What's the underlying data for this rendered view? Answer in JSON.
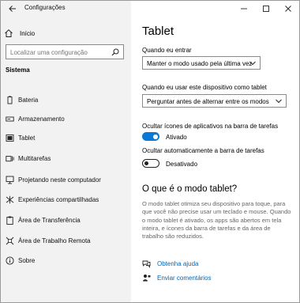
{
  "app": {
    "title": "Configurações"
  },
  "sidebar": {
    "home_label": "Início",
    "search_placeholder": "Localizar uma configuração",
    "section_title": "Sistema",
    "items": [
      {
        "label": "Bateria",
        "icon": "battery-icon"
      },
      {
        "label": "Armazenamento",
        "icon": "storage-icon"
      },
      {
        "label": "Tablet",
        "icon": "tablet-icon"
      },
      {
        "label": "Multitarefas",
        "icon": "multitasking-icon"
      },
      {
        "label": "Projetando neste computador",
        "icon": "projecting-icon"
      },
      {
        "label": "Experiências compartilhadas",
        "icon": "shared-experiences-icon"
      },
      {
        "label": "Área de Transferência",
        "icon": "clipboard-icon"
      },
      {
        "label": "Área de Trabalho Remota",
        "icon": "remote-desktop-icon"
      },
      {
        "label": "Sobre",
        "icon": "info-icon"
      }
    ]
  },
  "main": {
    "title": "Tablet",
    "signin_label": "Quando eu entrar",
    "signin_value": "Manter o modo usado pela última vez",
    "usage_label": "Quando eu usar este dispositivo como tablet",
    "usage_value": "Perguntar antes de alternar entre os modos",
    "hide_icons_label": "Ocultar ícones de aplicativos na barra de tarefas",
    "hide_icons_state": "Ativado",
    "auto_hide_label": "Ocultar automaticamente a barra de tarefas",
    "auto_hide_state": "Desativado",
    "subheading": "O que é o modo tablet?",
    "description": "O modo tablet otimiza seu dispositivo para toque, para que você não precise usar um teclado e mouse. Quando o modo tablet é ativado, os apps são abertos em tela inteira, e ícones da barra de tarefas e da área de trabalho são reduzidos.",
    "help_link": "Obtenha ajuda",
    "feedback_link": "Enviar comentários"
  },
  "colors": {
    "accent": "#0a78d4",
    "link": "#0067b8",
    "sidebar_bg": "#f2f2f2"
  }
}
